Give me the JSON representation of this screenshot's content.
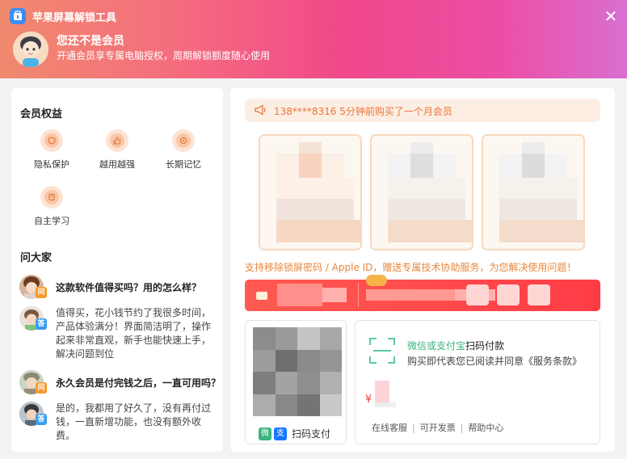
{
  "header": {
    "app_title": "苹果屏幕解锁工具",
    "close_label": "✕",
    "user_name": "您还不是会员",
    "user_desc": "开通会员享专属电脑授权，周期解锁额度随心使用"
  },
  "benefits": {
    "title": "会员权益",
    "items": [
      {
        "label": "隐私保护",
        "icon": "shield-icon"
      },
      {
        "label": "越用越强",
        "icon": "thumb-up-icon"
      },
      {
        "label": "长期记忆",
        "icon": "memory-icon"
      },
      {
        "label": "自主学习",
        "icon": "book-icon"
      }
    ]
  },
  "qa": {
    "title": "问大家",
    "q_badge": "问",
    "a_badge": "答",
    "items": [
      {
        "question": "这款软件值得买吗？用的怎么样？",
        "answer": "值得买，花小钱节约了我很多时间，产品体验满分！界面简洁明了，操作起来非常直观，新手也能快速上手，解决问题到位"
      },
      {
        "question": "永久会员是付完钱之后，一直可用吗？",
        "answer": "是的，我都用了好久了，没有再付过钱，一直新增功能，也没有额外收费。"
      }
    ]
  },
  "notice": {
    "text": "138****8316 5分钟前购买了一个月会员"
  },
  "support_text": "支持移除锁屏密码 / Apple ID，赠送专属技术协助服务，为您解决使用问题！",
  "payment": {
    "scan_label": "扫码支付",
    "wechat_icon_text": "微",
    "alipay_icon_text": "支",
    "method_highlight": "微信或支付宝",
    "method_rest": "扫码付款",
    "agreement": "购买即代表您已阅读并同意《服务条款》",
    "currency": "¥",
    "links": [
      "在线客服",
      "可开发票",
      "帮助中心"
    ]
  },
  "colors": {
    "accent_orange": "#e8763a",
    "buy_red": "#ff4448",
    "wechat_green": "#3bb37d",
    "alipay_blue": "#1677ff"
  }
}
